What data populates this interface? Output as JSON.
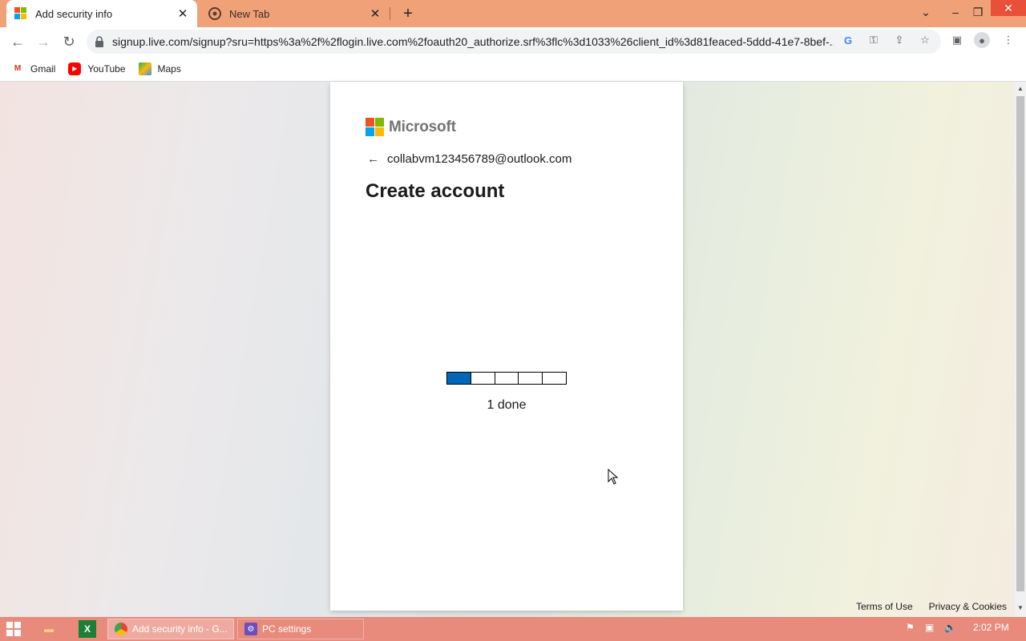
{
  "browser": {
    "tabs": [
      {
        "title": "Add security info",
        "icon": "microsoft-favicon",
        "active": true
      },
      {
        "title": "New Tab",
        "icon": "chrome-favicon",
        "active": false
      }
    ],
    "new_tab_symbol": "+",
    "url": "signup.live.com/signup?sru=https%3a%2f%2flogin.live.com%2foauth20_authorize.srf%3flc%3d1033%26client_id%3d81feaced-5ddd-41e7-8bef-...",
    "bookmarks": [
      {
        "label": "Gmail",
        "icon": "gmail-icon"
      },
      {
        "label": "YouTube",
        "icon": "youtube-icon"
      },
      {
        "label": "Maps",
        "icon": "maps-icon"
      }
    ]
  },
  "page": {
    "brand": "Microsoft",
    "brand_colors": [
      "#f25022",
      "#7fba00",
      "#00a4ef",
      "#ffb900"
    ],
    "identity": "collabvm123456789@outlook.com",
    "heading": "Create account",
    "progress": {
      "total_steps": 5,
      "completed_steps": 1,
      "label": "1 done",
      "fill_color": "#0067b8"
    },
    "footer_links": [
      "Terms of Use",
      "Privacy & Cookies"
    ]
  },
  "taskbar": {
    "tasks": [
      {
        "label": "Add security info - G...",
        "icon": "chrome-icon",
        "active": true
      },
      {
        "label": "PC settings",
        "icon": "settings-gear-icon",
        "active": false
      }
    ],
    "clock": "2:02 PM"
  }
}
